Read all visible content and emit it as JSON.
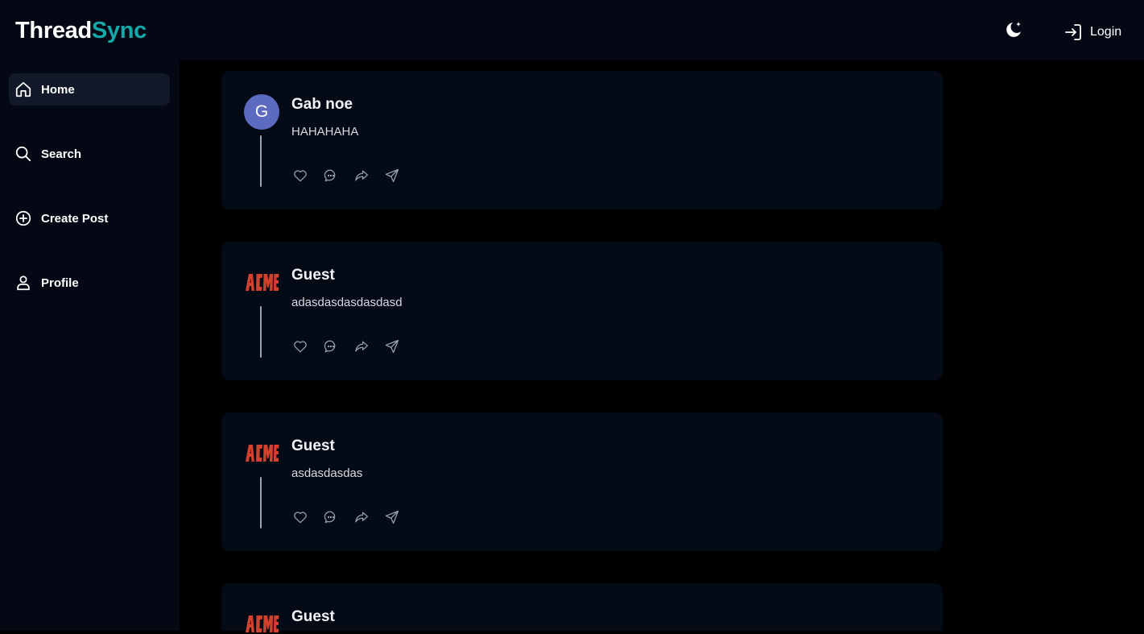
{
  "app": {
    "logo_part1": "Thread",
    "logo_part2": "Sync",
    "brand_color": "#16a8a8",
    "login_label": "Login",
    "theme_icon": "moon-stars-icon",
    "login_icon": "login-icon"
  },
  "sidebar": {
    "items": [
      {
        "label": "Home",
        "icon": "home-icon",
        "active": true
      },
      {
        "label": "Search",
        "icon": "search-icon",
        "active": false
      },
      {
        "label": "Create Post",
        "icon": "plus-circle-icon",
        "active": false
      },
      {
        "label": "Profile",
        "icon": "user-icon",
        "active": false
      }
    ]
  },
  "posts": [
    {
      "author": "Gab noe",
      "avatar_letter": "G",
      "avatar_color": "#5c6bc0",
      "content": "HAHAHAHA"
    },
    {
      "author": "Guest",
      "avatar_logo": "ACME",
      "content": "adasdasdasdasdasd"
    },
    {
      "author": "Guest",
      "avatar_logo": "ACME",
      "content": "asdasdasdas"
    },
    {
      "author": "Guest",
      "avatar_logo": "ACME",
      "content": ""
    }
  ],
  "post_actions": [
    "heart-icon",
    "comment-icon",
    "share-icon",
    "send-icon"
  ]
}
